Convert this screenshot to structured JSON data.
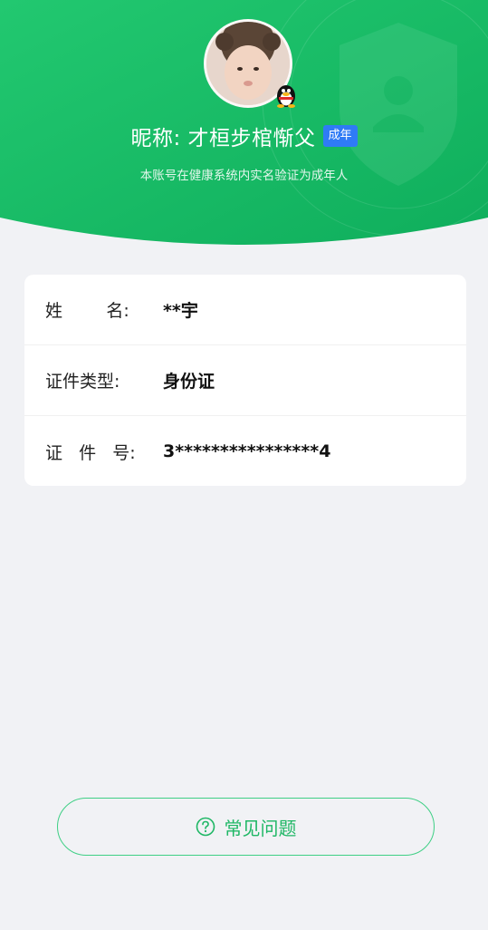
{
  "header": {
    "nickname": "昵称: 才桓步棺惭父",
    "adult_badge": "成年",
    "subtitle": "本账号在健康系统内实名验证为成年人",
    "avatar_icon": "baby-avatar",
    "badge_icon": "qq-penguin-icon",
    "shield_icon": "shield-user-icon",
    "colors": {
      "gradient_start": "#1fc36c",
      "gradient_end": "#0fae5c",
      "badge": "#2f7bf5"
    }
  },
  "info": [
    {
      "label": "姓        名:",
      "value": "**宇"
    },
    {
      "label": "证件类型:",
      "value": "身份证"
    },
    {
      "label": "证   件   号:",
      "value": "3****************4"
    }
  ],
  "faq": {
    "label": "常见问题",
    "icon": "question-circle-icon",
    "color": "#1fb765"
  }
}
